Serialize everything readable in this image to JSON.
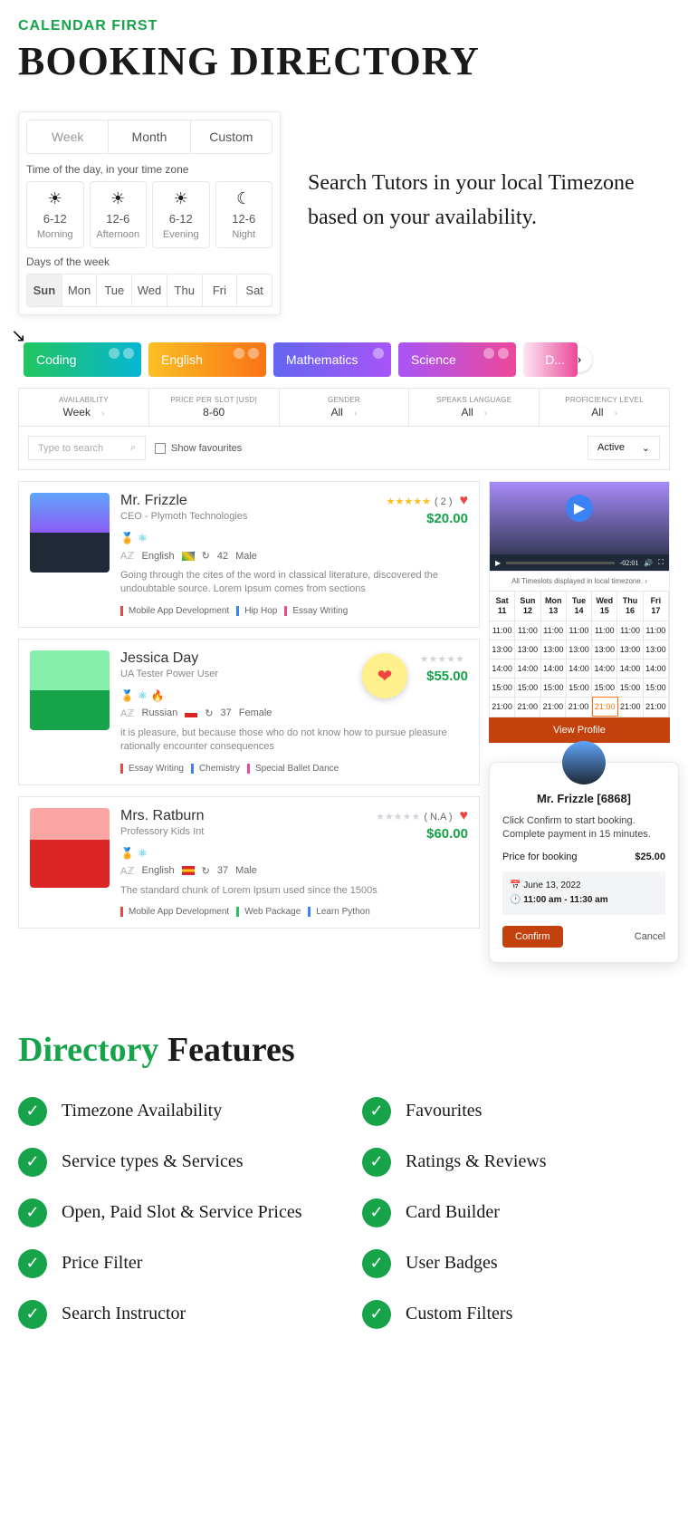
{
  "eyebrow": "CALENDAR FIRST",
  "title": "BOOKING DIRECTORY",
  "hero_text": "Search Tutors in your local Timezone based on your availability.",
  "calendar": {
    "tabs": [
      "Week",
      "Month",
      "Custom"
    ],
    "time_label": "Time of the day, in your time zone",
    "dayparts": [
      {
        "icon": "sunrise",
        "range": "6-12",
        "label": "Morning"
      },
      {
        "icon": "sun",
        "range": "12-6",
        "label": "Afternoon"
      },
      {
        "icon": "sunset",
        "range": "6-12",
        "label": "Evening"
      },
      {
        "icon": "moon",
        "range": "12-6",
        "label": "Night"
      }
    ],
    "days_label": "Days of the week",
    "days": [
      "Sun",
      "Mon",
      "Tue",
      "Wed",
      "Thu",
      "Fri",
      "Sat"
    ]
  },
  "categories": [
    "Coding",
    "English",
    "Mathematics",
    "Science",
    "D..."
  ],
  "filters": {
    "availability": {
      "label": "AVAILABILITY",
      "value": "Week"
    },
    "price": {
      "label": "PRICE PER SLOT [USD]",
      "value": "8-60"
    },
    "gender": {
      "label": "GENDER",
      "value": "All"
    },
    "language": {
      "label": "SPEAKS LANGUAGE",
      "value": "All"
    },
    "proficiency": {
      "label": "PROFICIENCY LEVEL",
      "value": "All"
    }
  },
  "search": {
    "placeholder": "Type to search",
    "favourites": "Show favourites",
    "status": "Active"
  },
  "tutors": [
    {
      "name": "Mr. Frizzle",
      "subtitle": "CEO - Plymoth Technologies",
      "price": "$20.00",
      "stars_filled": true,
      "reviews": "( 2 )",
      "heart": true,
      "meta_lang": "English",
      "meta_age": "42",
      "meta_gender": "Male",
      "flag": "br",
      "desc": "Going through the cites of the word in classical literature, discovered the undoubtable source. Lorem Ipsum comes from sections",
      "tags": [
        {
          "t": "Mobile App Development",
          "c": "red"
        },
        {
          "t": "Hip Hop",
          "c": "blue"
        },
        {
          "t": "Essay Writing",
          "c": "pink"
        }
      ]
    },
    {
      "name": "Jessica Day",
      "subtitle": "UA Tester Power User",
      "price": "$55.00",
      "stars_filled": false,
      "reviews": "",
      "heart": false,
      "meta_lang": "Russian",
      "meta_age": "37",
      "meta_gender": "Female",
      "flag": "cl",
      "desc": "it is pleasure, but because those who do not know how to pursue pleasure rationally encounter consequences",
      "tags": [
        {
          "t": "Essay Writing",
          "c": "red"
        },
        {
          "t": "Chemistry",
          "c": "blue"
        },
        {
          "t": "Special Ballet Dance",
          "c": "pink"
        }
      ]
    },
    {
      "name": "Mrs. Ratburn",
      "subtitle": "Professory Kids Int",
      "price": "$60.00",
      "stars_filled": false,
      "reviews": "( N.A )",
      "heart": true,
      "meta_lang": "English",
      "meta_age": "37",
      "meta_gender": "Male",
      "flag": "es",
      "desc": "The standard chunk of Lorem Ipsum used since the 1500s",
      "tags": [
        {
          "t": "Mobile App Development",
          "c": "red"
        },
        {
          "t": "Web Package",
          "c": "green"
        },
        {
          "t": "Learn Python",
          "c": "blue"
        }
      ]
    }
  ],
  "video": {
    "time": "-02:01"
  },
  "slots": {
    "tz_note": "All Timeslots displayed in local timezone.",
    "head": [
      {
        "d": "Sat",
        "n": "11"
      },
      {
        "d": "Sun",
        "n": "12"
      },
      {
        "d": "Mon",
        "n": "13"
      },
      {
        "d": "Tue",
        "n": "14"
      },
      {
        "d": "Wed",
        "n": "15"
      },
      {
        "d": "Thu",
        "n": "16"
      },
      {
        "d": "Fri",
        "n": "17"
      }
    ],
    "rows": [
      [
        "11:00",
        "11:00",
        "11:00",
        "11:00",
        "11:00",
        "11:00",
        "11:00"
      ],
      [
        "13:00",
        "13:00",
        "13:00",
        "13:00",
        "13:00",
        "13:00",
        "13:00"
      ],
      [
        "14:00",
        "14:00",
        "14:00",
        "14:00",
        "14:00",
        "14:00",
        "14:00"
      ],
      [
        "15:00",
        "15:00",
        "15:00",
        "15:00",
        "15:00",
        "15:00",
        "15:00"
      ],
      [
        "21:00",
        "21:00",
        "21:00",
        "21:00",
        "21:00",
        "21:00",
        "21:00"
      ]
    ],
    "highlighted": {
      "row": 4,
      "col": 4
    },
    "view_profile": "View Profile"
  },
  "booking": {
    "name": "Mr. Frizzle [6868]",
    "text": "Click Confirm to start booking. Complete payment in 15 minutes.",
    "price_label": "Price for booking",
    "price": "$25.00",
    "date": "June 13, 2022",
    "time": "11:00 am  -  11:30 am",
    "confirm": "Confirm",
    "cancel": "Cancel"
  },
  "features": {
    "title_green": "Directory",
    "title_black": " Features",
    "items": [
      "Timezone Availability",
      "Favourites",
      "Service types & Services",
      "Ratings & Reviews",
      "Open, Paid Slot & Service Prices",
      "Card Builder",
      "Price Filter",
      "User Badges",
      "Search Instructor",
      "Custom Filters"
    ]
  }
}
